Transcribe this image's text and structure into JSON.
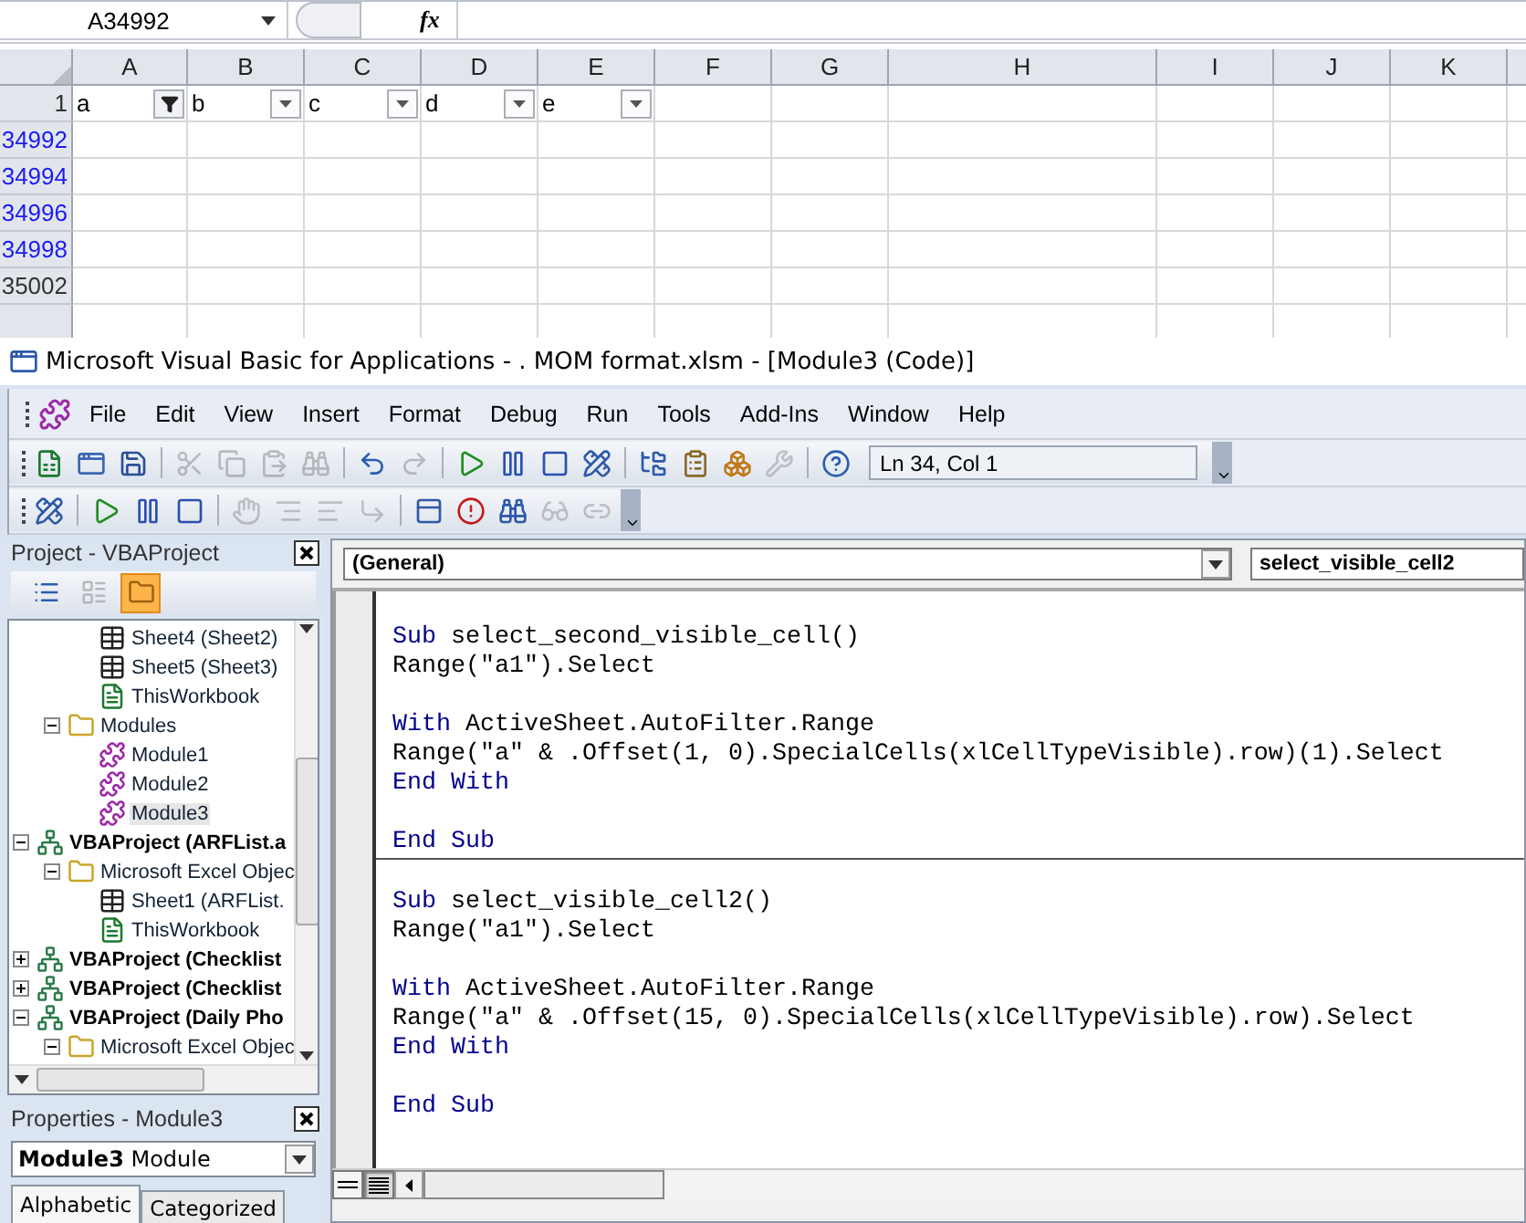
{
  "excel": {
    "name_box": "A34992",
    "formula_label": "fx",
    "columns": [
      "A",
      "B",
      "C",
      "D",
      "E",
      "F",
      "G",
      "H",
      "I",
      "J",
      "K"
    ],
    "header_row": {
      "number": "1",
      "cells": [
        {
          "text": "a",
          "filtered": true
        },
        {
          "text": "b",
          "filtered": false
        },
        {
          "text": "c",
          "filtered": false
        },
        {
          "text": "d",
          "filtered": false
        },
        {
          "text": "e",
          "filtered": false
        }
      ]
    },
    "rows": [
      {
        "number": "34992",
        "filtered": true
      },
      {
        "number": "34994",
        "filtered": true
      },
      {
        "number": "34996",
        "filtered": true
      },
      {
        "number": "34998",
        "filtered": true
      },
      {
        "number": "35002",
        "filtered": false
      }
    ]
  },
  "vbe": {
    "title": "Microsoft Visual Basic for Applications - . MOM format.xlsm - [Module3 (Code)]",
    "menu": [
      "File",
      "Edit",
      "View",
      "Insert",
      "Format",
      "Debug",
      "Run",
      "Tools",
      "Add-Ins",
      "Window",
      "Help"
    ],
    "toolbars": [
      [
        {
          "kind": "excel",
          "disabled": false
        },
        {
          "kind": "insert-form",
          "disabled": false
        },
        {
          "kind": "save",
          "disabled": false
        },
        {
          "kind": "separator"
        },
        {
          "kind": "cut",
          "disabled": true
        },
        {
          "kind": "copy",
          "disabled": true
        },
        {
          "kind": "paste",
          "disabled": true
        },
        {
          "kind": "find",
          "disabled": true
        },
        {
          "kind": "separator"
        },
        {
          "kind": "undo",
          "disabled": false
        },
        {
          "kind": "redo",
          "disabled": true
        },
        {
          "kind": "separator"
        },
        {
          "kind": "run",
          "disabled": false
        },
        {
          "kind": "pause",
          "disabled": false
        },
        {
          "kind": "stop",
          "disabled": false
        },
        {
          "kind": "design",
          "disabled": false
        },
        {
          "kind": "separator"
        },
        {
          "kind": "explorer",
          "disabled": false
        },
        {
          "kind": "properties",
          "disabled": false
        },
        {
          "kind": "browser",
          "disabled": false
        },
        {
          "kind": "toolbox",
          "disabled": true
        },
        {
          "kind": "separator"
        },
        {
          "kind": "help",
          "disabled": false
        }
      ],
      [
        {
          "kind": "design",
          "disabled": false
        },
        {
          "kind": "separator"
        },
        {
          "kind": "run",
          "disabled": false
        },
        {
          "kind": "pause",
          "disabled": false
        },
        {
          "kind": "stop",
          "disabled": false
        },
        {
          "kind": "separator"
        },
        {
          "kind": "hand",
          "disabled": true
        },
        {
          "kind": "indent",
          "disabled": true
        },
        {
          "kind": "outdent",
          "disabled": true
        },
        {
          "kind": "step",
          "disabled": true
        },
        {
          "kind": "separator"
        },
        {
          "kind": "window",
          "disabled": false
        },
        {
          "kind": "alert",
          "disabled": false
        },
        {
          "kind": "watch",
          "disabled": false
        },
        {
          "kind": "glasses",
          "disabled": true
        },
        {
          "kind": "stack",
          "disabled": true
        }
      ]
    ],
    "position": "Ln 34, Col 1",
    "project": {
      "title": "Project - VBAProject",
      "buttons": [
        {
          "kind": "code",
          "selected": false,
          "disabled": false
        },
        {
          "kind": "object",
          "selected": false,
          "disabled": true
        },
        {
          "kind": "folders",
          "selected": true,
          "disabled": false
        }
      ],
      "tree": [
        {
          "children": [
            {
              "children": [
                {
                  "label": "Sheet4 (Sheet2)",
                  "kind": "sheet",
                  "selected": false
                },
                {
                  "label": "Sheet5 (Sheet3)",
                  "kind": "sheet",
                  "selected": false
                },
                {
                  "label": "ThisWorkbook",
                  "kind": "workbook",
                  "selected": false
                }
              ]
            },
            {
              "label": "Modules",
              "kind": "folder",
              "expanded": true,
              "selected": false,
              "children": [
                {
                  "label": "Module1",
                  "kind": "module",
                  "selected": false
                },
                {
                  "label": "Module2",
                  "kind": "module",
                  "selected": false
                },
                {
                  "label": "Module3",
                  "kind": "module",
                  "selected": true
                }
              ]
            }
          ]
        },
        {
          "label": "VBAProject (ARFList.a",
          "kind": "project",
          "expanded": true,
          "selected": false,
          "children": [
            {
              "label": "Microsoft Excel Objec",
              "kind": "folder",
              "expanded": true,
              "selected": false,
              "children": [
                {
                  "label": "Sheet1 (ARFList.",
                  "kind": "sheet",
                  "selected": false
                },
                {
                  "label": "ThisWorkbook",
                  "kind": "workbook",
                  "selected": false
                }
              ]
            }
          ]
        },
        {
          "label": "VBAProject (Checklist",
          "kind": "project",
          "expanded": false,
          "selected": false
        },
        {
          "label": "VBAProject (Checklist",
          "kind": "project",
          "expanded": false,
          "selected": false
        },
        {
          "label": "VBAProject (Daily Pho",
          "kind": "project",
          "expanded": true,
          "selected": false,
          "children": [
            {
              "label": "Microsoft Excel Objec",
              "kind": "folder",
              "expanded": true,
              "selected": false
            }
          ]
        }
      ]
    },
    "properties": {
      "title": "Properties - Module3",
      "object": "**Module3** Module",
      "tabs": [
        {
          "label": "Alphabetic",
          "selected": true
        },
        {
          "label": "Categorized",
          "selected": false
        }
      ]
    },
    "code": {
      "object": "(General)",
      "procedure": "select_visible_cell2",
      "procedures": [
        {
          "lines": [
            {
              "kind": "blank"
            },
            {
              "kind": "code",
              "segments": [
                {
                  "text": "Sub",
                  "keyword": true
                },
                {
                  "text": " select_second_visible_cell()",
                  "keyword": false
                }
              ]
            },
            {
              "kind": "code",
              "segments": [
                {
                  "text": "Range(\"a1\").Select",
                  "keyword": false
                }
              ]
            },
            {
              "kind": "blank"
            },
            {
              "kind": "code",
              "segments": [
                {
                  "text": "With",
                  "keyword": true
                },
                {
                  "text": " ActiveSheet.AutoFilter.Range",
                  "keyword": false
                }
              ]
            },
            {
              "kind": "code",
              "segments": [
                {
                  "text": "Range(\"a\" & .Offset(1, 0).SpecialCells(xlCellTypeVisible).row)(1).Select",
                  "keyword": false
                }
              ]
            },
            {
              "kind": "code",
              "segments": [
                {
                  "text": "End With",
                  "keyword": true
                }
              ]
            },
            {
              "kind": "blank"
            },
            {
              "kind": "code",
              "segments": [
                {
                  "text": "End Sub",
                  "keyword": true
                }
              ]
            }
          ]
        },
        {
          "lines": [
            {
              "kind": "blank"
            },
            {
              "kind": "code",
              "segments": [
                {
                  "text": "Sub",
                  "keyword": true
                },
                {
                  "text": " select_visible_cell2()",
                  "keyword": false
                }
              ]
            },
            {
              "kind": "code",
              "segments": [
                {
                  "text": "Range(\"a1\").Select",
                  "keyword": false
                }
              ]
            },
            {
              "kind": "blank"
            },
            {
              "kind": "code",
              "segments": [
                {
                  "text": "With",
                  "keyword": true
                },
                {
                  "text": " ActiveSheet.AutoFilter.Range",
                  "keyword": false
                }
              ]
            },
            {
              "kind": "code",
              "segments": [
                {
                  "text": "Range(\"a\" & .Offset(15, 0).SpecialCells(xlCellTypeVisible).row).Select",
                  "keyword": false
                }
              ]
            },
            {
              "kind": "code",
              "segments": [
                {
                  "text": "End With",
                  "keyword": true
                }
              ]
            },
            {
              "kind": "blank"
            },
            {
              "kind": "code",
              "segments": [
                {
                  "text": "End Sub",
                  "keyword": true
                }
              ]
            }
          ]
        }
      ],
      "views": [
        {
          "kind": "procedure",
          "selected": false
        },
        {
          "kind": "module",
          "selected": true
        }
      ]
    }
  }
}
